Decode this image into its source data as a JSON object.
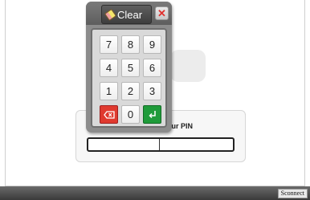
{
  "pin_form": {
    "label": "our PIN",
    "input_value": ""
  },
  "keypad": {
    "clear_label": "Clear",
    "clear_icon": "eraser-icon",
    "close_icon": "close-icon",
    "keys": [
      "7",
      "8",
      "9",
      "4",
      "5",
      "6",
      "1",
      "2",
      "3",
      "backspace",
      "0",
      "enter"
    ],
    "backspace_color": "#e03a2f",
    "enter_color": "#1f9b3a"
  },
  "footer": {
    "badge_label": "Sconnect"
  }
}
